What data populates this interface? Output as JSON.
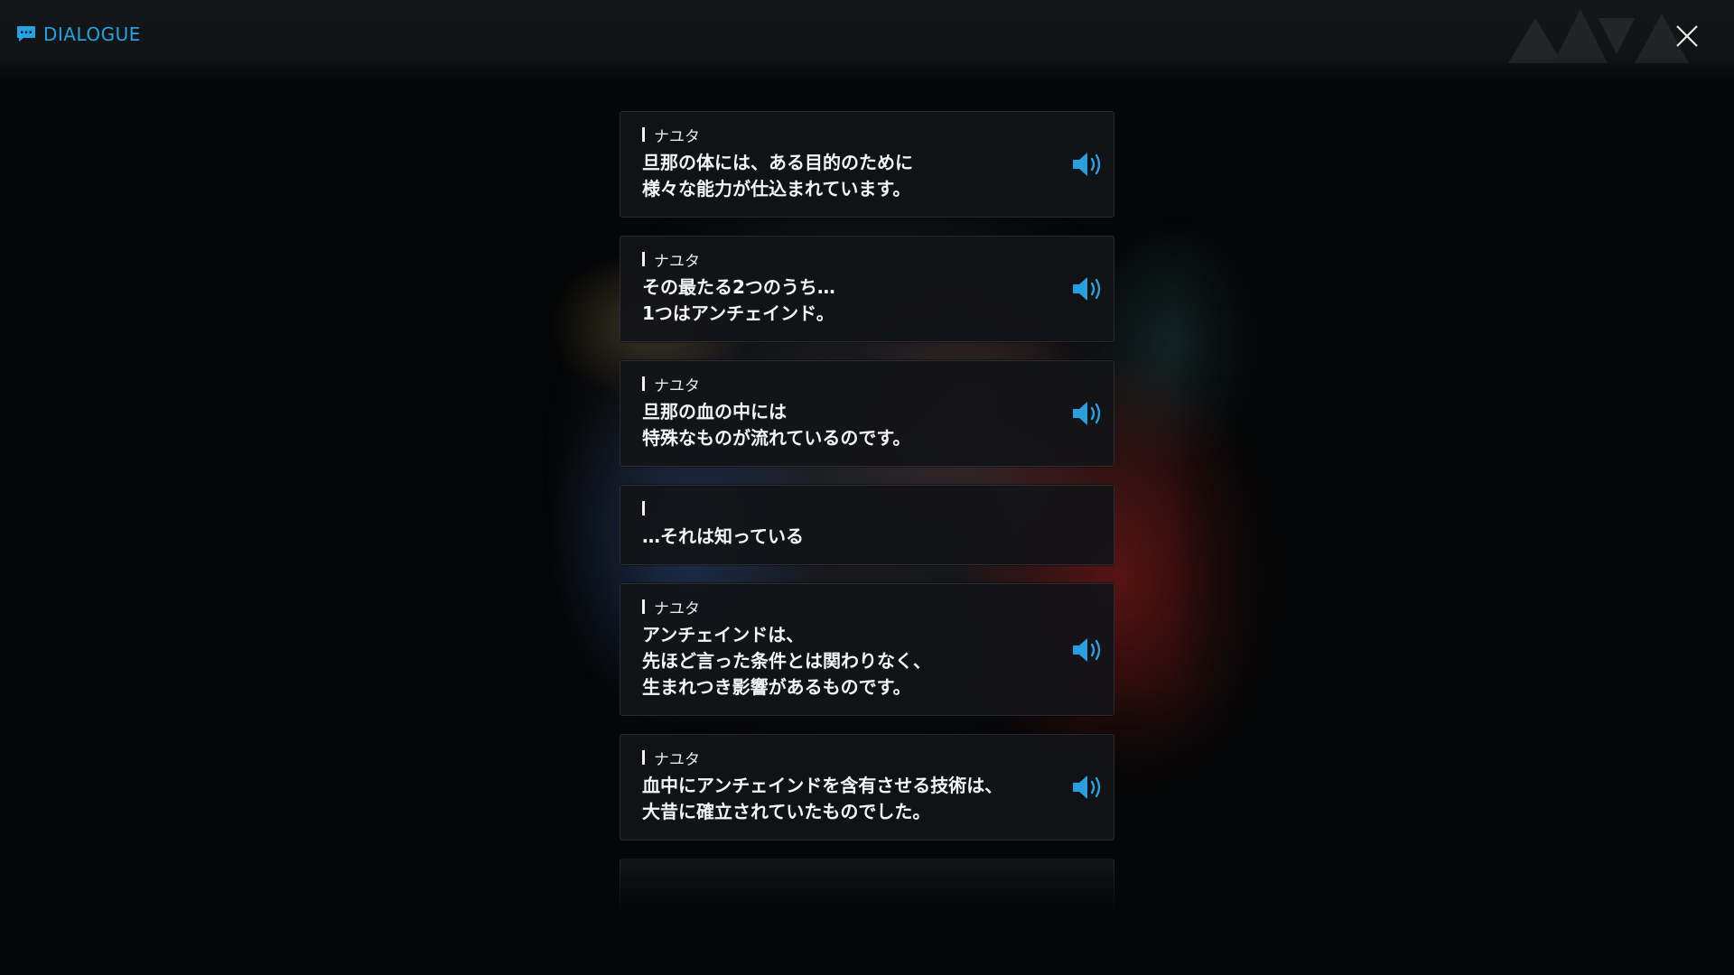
{
  "header": {
    "title": "DIALOGUE",
    "title_icon": "chat-bubble-icon",
    "close_icon": "close-icon",
    "accent_color": "#22a3e6"
  },
  "dialogue": [
    {
      "speaker": "ナユタ",
      "text": "旦那の体には、ある目的のために\n様々な能力が仕込まれています。",
      "has_voice": true
    },
    {
      "speaker": "ナユタ",
      "text": "その最たる2つのうち…\n1つはアンチェインド。",
      "has_voice": true
    },
    {
      "speaker": "ナユタ",
      "text": "旦那の血の中には\n特殊なものが流れているのです。",
      "has_voice": true
    },
    {
      "speaker": "",
      "text": "…それは知っている",
      "has_voice": false
    },
    {
      "speaker": "ナユタ",
      "text": "アンチェインドは、\n先ほど言った条件とは関わりなく、\n生まれつき影響があるものです。",
      "has_voice": true
    },
    {
      "speaker": "ナユタ",
      "text": "血中にアンチェインドを含有させる技術は、\n大昔に確立されていたものでした。",
      "has_voice": true
    }
  ],
  "voice_icon": "speaker-volume-icon"
}
